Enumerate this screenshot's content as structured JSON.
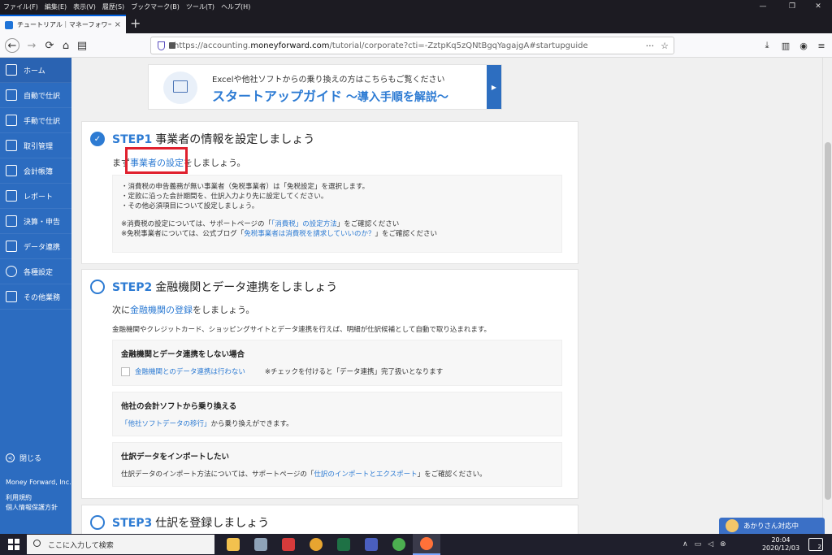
{
  "menubar": {
    "items": [
      "ファイル(F)",
      "編集(E)",
      "表示(V)",
      "履歴(S)",
      "ブックマーク(B)",
      "ツール(T)",
      "ヘルプ(H)"
    ],
    "minimize": "—",
    "maximize": "❐",
    "close": "✕"
  },
  "tab": {
    "title": "チュートリアル｜マネーフォワード ク",
    "close": "×",
    "newtab": "+"
  },
  "nav": {
    "url_prefix": "https://accounting.",
    "url_domain": "moneyforward.com",
    "url_suffix": "/tutorial/corporate?cti=-ZztpKq5zQNtBgqYagajgA#startupguide",
    "url_more": "···",
    "back": "←",
    "forward": "→",
    "reload": "⟳",
    "home": "⌂",
    "print": "▤",
    "bookmark": "☆"
  },
  "sidebar": {
    "items": [
      {
        "label": "ホーム",
        "icon": "home-icon"
      },
      {
        "label": "自動で仕訳",
        "icon": "auto-journal-icon"
      },
      {
        "label": "手動で仕訳",
        "icon": "manual-journal-icon"
      },
      {
        "label": "取引管理",
        "icon": "transaction-icon"
      },
      {
        "label": "会計帳簿",
        "icon": "ledger-icon"
      },
      {
        "label": "レポート",
        "icon": "report-icon"
      },
      {
        "label": "決算・申告",
        "icon": "settlement-icon"
      },
      {
        "label": "データ連携",
        "icon": "data-link-icon"
      },
      {
        "label": "各種設定",
        "icon": "gear-icon"
      },
      {
        "label": "その他業務",
        "icon": "list-icon"
      }
    ],
    "close_label": "閉じる",
    "company": "Money Forward, Inc.",
    "terms": "利用規約",
    "privacy": "個人情報保護方針"
  },
  "banner": {
    "subtitle": "Excelや他社ソフトからの乗り換えの方はこちらもご覧ください",
    "title_main": "スタートアップガイド",
    "title_sub": " ～導入手順を解説～"
  },
  "step1": {
    "num": "STEP1",
    "title": "事業者の情報を設定しましょう",
    "lead_pre": "まず",
    "lead_link": "事業者の設定",
    "lead_post": "をしましょう。",
    "bullets": [
      "・消費税の申告義務が無い事業者（免税事業者）は「免税設定」を選択します。",
      "・定款に沿った会計期間を、仕訳入力より先に設定してください。",
      "・その他必須項目について設定しましょう。"
    ],
    "note1_pre": "※消費税の設定については、サポートページの「",
    "note1_link": "「消費税」の設定方法",
    "note1_post": "」をご確認ください",
    "note2_pre": "※免税事業者については、公式ブログ「",
    "note2_link": "免税事業者は消費税を請求していいのか？",
    "note2_post": "」をご確認ください"
  },
  "step2": {
    "num": "STEP2",
    "title": "金融機関とデータ連携をしましょう",
    "lead_pre": "次に",
    "lead_link": "金融機関の登録",
    "lead_post": "をしましょう。",
    "desc": "金融機関やクレジットカード、ショッピングサイトとデータ連携を行えば、明細が仕訳候補として自動で取り込まれます。",
    "box1_title": "金融機関とデータ連携をしない場合",
    "box1_link": "金融機関とのデータ連携は行わない",
    "box1_note": "※チェックを付けると「データ連携」完了扱いとなります",
    "box2_title": "他社の会計ソフトから乗り換える",
    "box2_link": "「他社ソフトデータの移行」",
    "box2_post": "から乗り換えができます。",
    "box3_title": "仕訳データをインポートしたい",
    "box3_pre": "仕訳データのインポート方法については、サポートページの「",
    "box3_link": "仕訳のインポートとエクスポート",
    "box3_post": "」をご確認ください。"
  },
  "step3": {
    "num": "STEP3",
    "title": "仕訳を登録しましょう"
  },
  "help": {
    "label": "あかりさん対応中"
  },
  "taskbar": {
    "search_placeholder": "ここに入力して検索",
    "time": "20:04",
    "date": "2020/12/03",
    "notif_count": "2"
  }
}
